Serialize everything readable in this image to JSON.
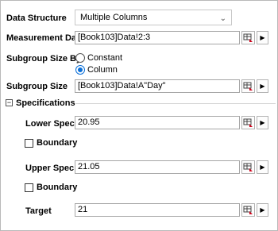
{
  "data_structure": {
    "label": "Data Structure",
    "value": "Multiple Columns"
  },
  "measurement_data": {
    "label": "Measurement Data",
    "value": "[Book103]Data!2:3"
  },
  "subgroup_size_by": {
    "label": "Subgroup Size By",
    "option1": "Constant",
    "option2": "Column",
    "selected": "Column"
  },
  "subgroup_size": {
    "label": "Subgroup Size",
    "value": "[Book103]Data!A\"Day\""
  },
  "specifications": {
    "label": "Specifications",
    "expanded_glyph": "−",
    "lower_spec": {
      "label": "Lower Spec",
      "value": "20.95"
    },
    "lower_boundary": {
      "label": "Boundary"
    },
    "upper_spec": {
      "label": "Upper Spec",
      "value": "21.05"
    },
    "upper_boundary": {
      "label": "Boundary"
    },
    "target": {
      "label": "Target",
      "value": "21"
    }
  },
  "icons": {
    "range_picker": "range-select-icon",
    "arrow": "triangle-right-icon",
    "dropdown": "chevron-down-icon"
  }
}
